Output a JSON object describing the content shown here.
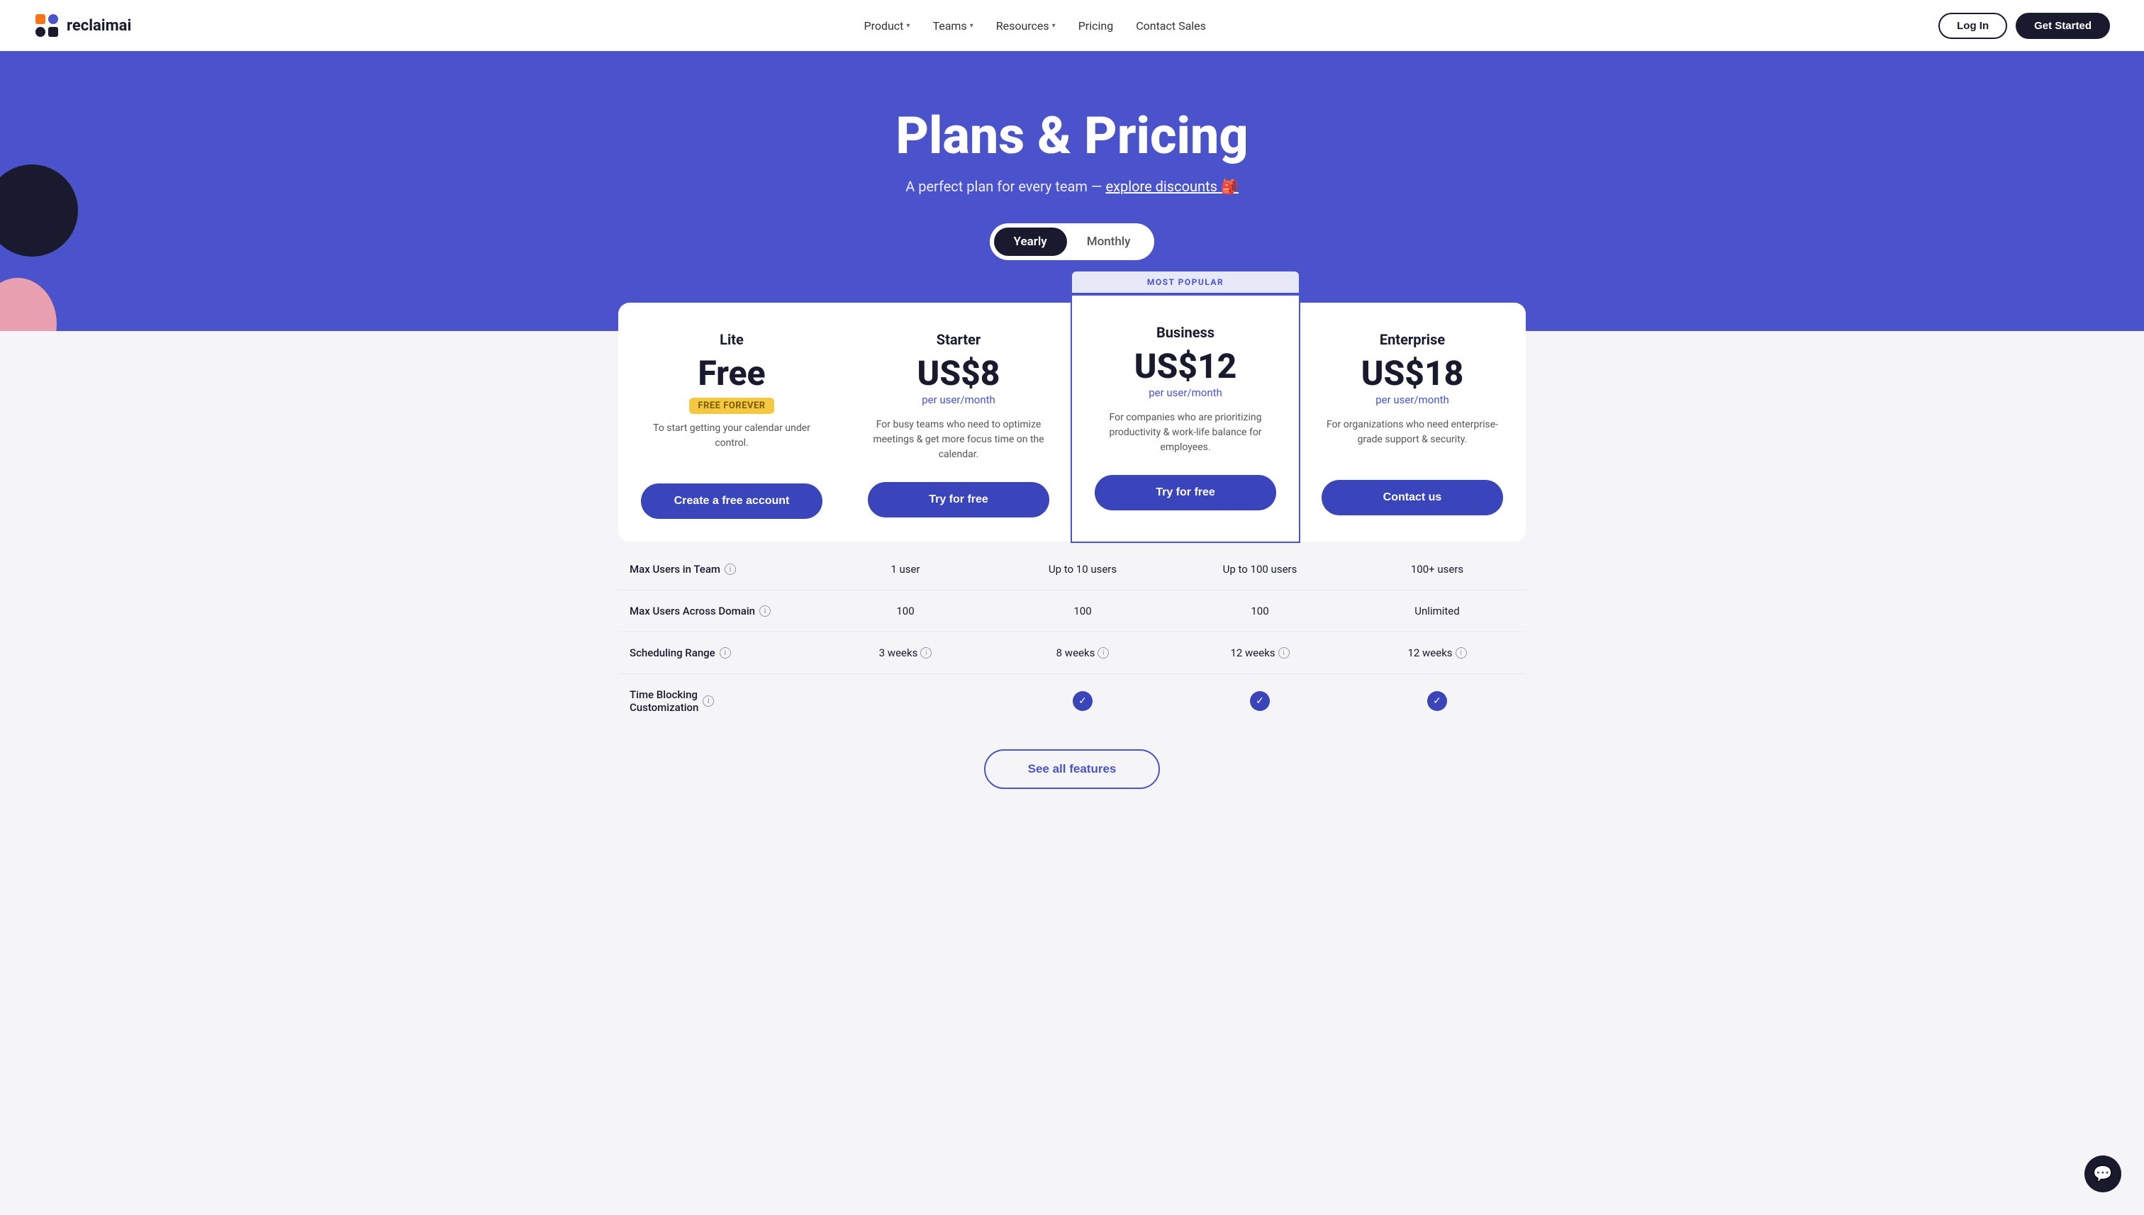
{
  "nav": {
    "logo_text": "reclaimai",
    "links": [
      {
        "label": "Product",
        "has_dropdown": true
      },
      {
        "label": "Teams",
        "has_dropdown": true
      },
      {
        "label": "Resources",
        "has_dropdown": true
      },
      {
        "label": "Pricing",
        "has_dropdown": false
      },
      {
        "label": "Contact Sales",
        "has_dropdown": false
      }
    ],
    "login_label": "Log In",
    "get_started_label": "Get Started"
  },
  "hero": {
    "title": "Plans & Pricing",
    "subtitle_prefix": "A perfect plan for every team — ",
    "subtitle_link": "explore discounts 🎒",
    "billing_yearly": "Yearly",
    "billing_monthly": "Monthly"
  },
  "plans": [
    {
      "id": "lite",
      "name": "Lite",
      "price": "Free",
      "price_badge": "FREE FOREVER",
      "price_period": "",
      "description": "To start getting your calendar under control.",
      "cta": "Create a free account",
      "popular": false
    },
    {
      "id": "starter",
      "name": "Starter",
      "price": "US$8",
      "price_badge": "",
      "price_period": "per user/month",
      "description": "For busy teams who need to optimize meetings & get more focus time on the calendar.",
      "cta": "Try for free",
      "popular": false
    },
    {
      "id": "business",
      "name": "Business",
      "price": "US$12",
      "price_badge": "",
      "price_period": "per user/month",
      "description": "For companies who are prioritizing productivity & work-life balance for employees.",
      "cta": "Try for free",
      "popular": true,
      "popular_label": "MOST POPULAR"
    },
    {
      "id": "enterprise",
      "name": "Enterprise",
      "price": "US$18",
      "price_badge": "",
      "price_period": "per user/month",
      "description": "For organizations who need enterprise-grade support & security.",
      "cta": "Contact us",
      "popular": false
    }
  ],
  "features": [
    {
      "label": "Max Users in Team",
      "has_info": true,
      "values": [
        "1 user",
        "Up to 10 users",
        "Up to 100 users",
        "100+ users"
      ],
      "value_infos": [
        false,
        false,
        false,
        false
      ],
      "check": [
        false,
        false,
        false,
        false
      ]
    },
    {
      "label": "Max Users Across Domain",
      "has_info": true,
      "values": [
        "100",
        "100",
        "100",
        "Unlimited"
      ],
      "value_infos": [
        false,
        false,
        false,
        false
      ],
      "check": [
        false,
        false,
        false,
        false
      ]
    },
    {
      "label": "Scheduling Range",
      "has_info": true,
      "values": [
        "3 weeks",
        "8 weeks",
        "12 weeks",
        "12 weeks"
      ],
      "value_infos": [
        true,
        true,
        true,
        true
      ],
      "check": [
        false,
        false,
        false,
        false
      ]
    },
    {
      "label": "Time Blocking Customization",
      "has_info": true,
      "values": [
        "",
        "",
        "",
        ""
      ],
      "value_infos": [
        false,
        false,
        false,
        false
      ],
      "check": [
        false,
        true,
        true,
        true
      ]
    }
  ],
  "see_all_features_label": "See all features"
}
